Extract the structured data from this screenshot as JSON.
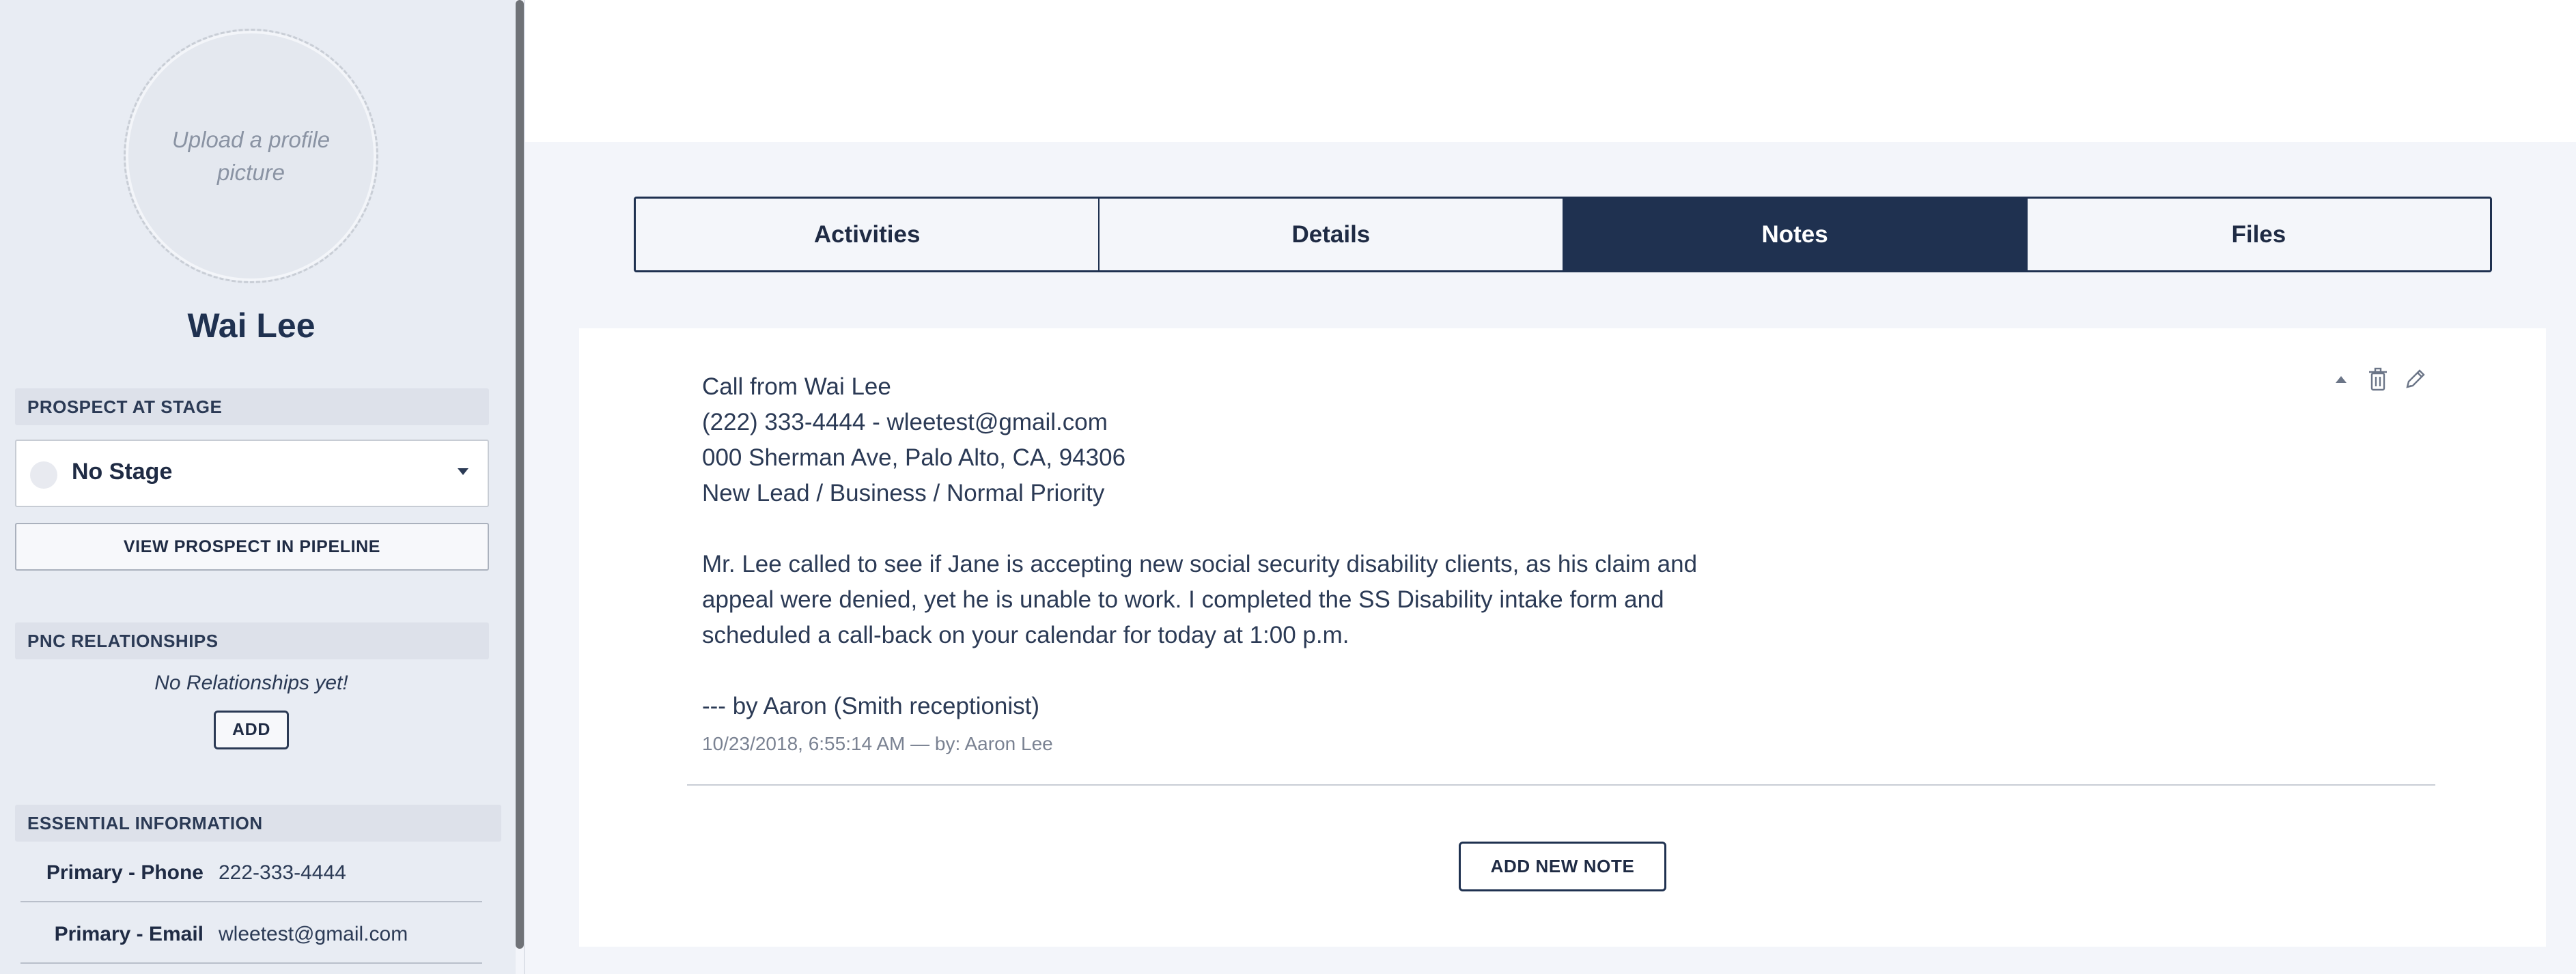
{
  "profile": {
    "upload_text": "Upload a profile picture",
    "name": "Wai Lee"
  },
  "stage": {
    "header": "PROSPECT AT STAGE",
    "selected": "No Stage",
    "view_button": "VIEW PROSPECT IN PIPELINE"
  },
  "relationships": {
    "header": "PNC RELATIONSHIPS",
    "empty_text": "No Relationships yet!",
    "add_button": "ADD"
  },
  "essential": {
    "header": "ESSENTIAL INFORMATION",
    "rows": [
      {
        "label": "Primary - Phone",
        "value": "222-333-4444"
      },
      {
        "label": "Primary - Email",
        "value": "wleetest@gmail.com"
      }
    ]
  },
  "tabs": [
    {
      "label": "Activities",
      "active": false
    },
    {
      "label": "Details",
      "active": false
    },
    {
      "label": "Notes",
      "active": true
    },
    {
      "label": "Files",
      "active": false
    }
  ],
  "note": {
    "lines": [
      "Call from Wai Lee",
      "(222) 333-4444 - wleetest@gmail.com",
      "000 Sherman Ave, Palo Alto, CA, 94306",
      "New Lead / Business / Normal Priority"
    ],
    "body": [
      "Mr. Lee called to see if Jane is accepting new social security disability clients, as his claim and",
      "appeal were denied, yet he is unable to work. I completed the SS Disability intake form and",
      "scheduled a call-back on your calendar for today at 1:00 p.m."
    ],
    "signature": "--- by Aaron (Smith receptionist)",
    "meta": "10/23/2018, 6:55:14 AM — by: Aaron Lee",
    "icons": [
      "collapse-icon",
      "trash-icon",
      "pencil-icon"
    ]
  },
  "add_note_button": "ADD NEW NOTE",
  "colors": {
    "navy": "#1f3150",
    "sidebar_bg": "#e8ecf3",
    "main_bg": "#f3f5fa"
  }
}
